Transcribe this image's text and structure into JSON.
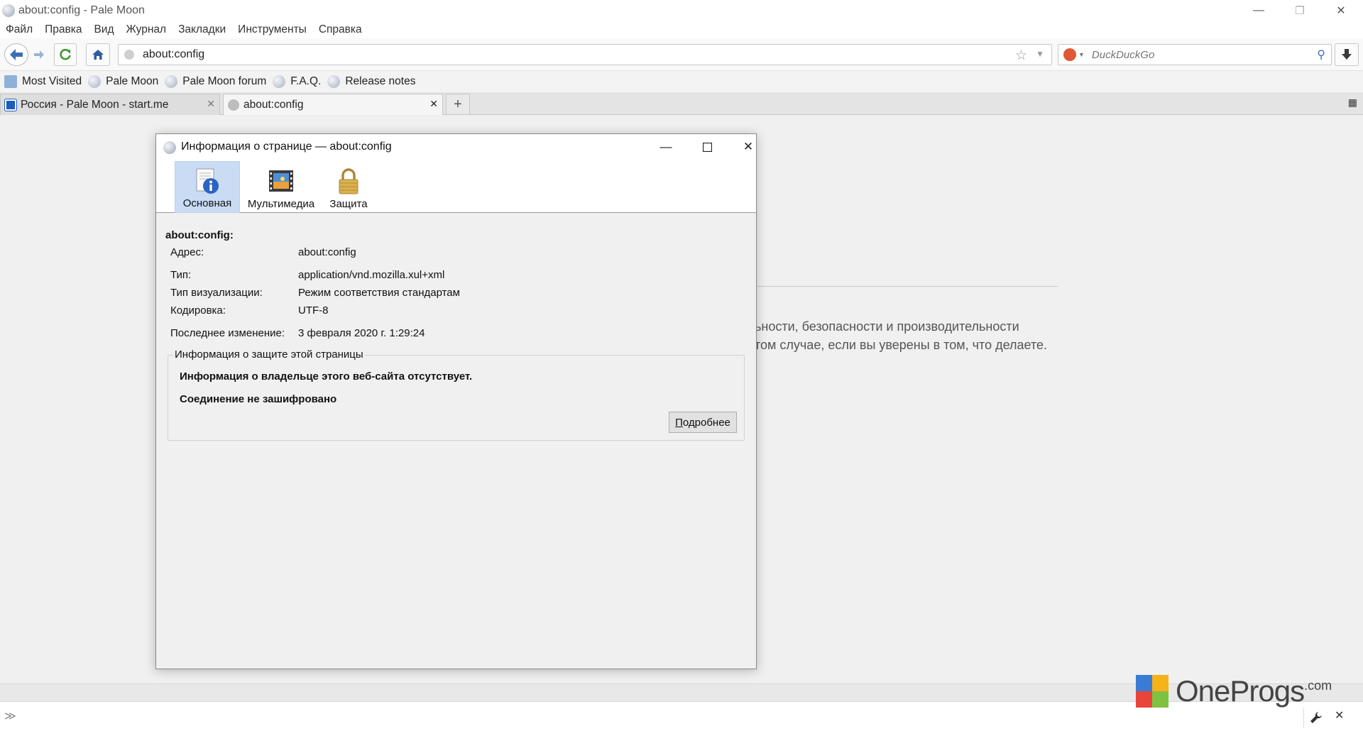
{
  "window": {
    "title": "about:config - Pale Moon",
    "minimize": "—",
    "restore": "❐",
    "close": "✕"
  },
  "menu": [
    "Файл",
    "Правка",
    "Вид",
    "Журнал",
    "Закладки",
    "Инструменты",
    "Справка"
  ],
  "nav": {
    "url": "about:config",
    "search_placeholder": "DuckDuckGo"
  },
  "bookmarks": [
    "Most Visited",
    "Pale Moon",
    "Pale Moon forum",
    "F.A.Q.",
    "Release notes"
  ],
  "tabs": [
    {
      "label": "Россия - Pale Moon - start.me"
    },
    {
      "label": "about:config"
    }
  ],
  "page_bg": {
    "warning_line1": "ьности, безопасности и производительности",
    "warning_line2": "том случае, если вы уверены в том, что делаете."
  },
  "dialog": {
    "title": "Информация о странице — about:config",
    "tabs": [
      "Основная",
      "Мультимедиа",
      "Защита"
    ],
    "page_title": "about:config:",
    "fields": [
      {
        "label": "Адрес:",
        "value": "about:config"
      },
      {
        "label": "Тип:",
        "value": "application/vnd.mozilla.xul+xml"
      },
      {
        "label": "Тип визуализации:",
        "value": "Режим соответствия стандартам"
      },
      {
        "label": "Кодировка:",
        "value": "UTF-8"
      },
      {
        "label": "Последнее изменение:",
        "value": "3 февраля 2020 г. 1:29:24"
      }
    ],
    "security": {
      "legend": "Информация о защите этой страницы",
      "owner": "Информация о владельце этого веб-сайта отсутствует.",
      "connection": "Соединение не зашифровано",
      "more_button_accel": "П",
      "more_button_rest": "одробнее"
    }
  },
  "watermark": {
    "name": "OneProgs",
    "suffix": ".com"
  }
}
